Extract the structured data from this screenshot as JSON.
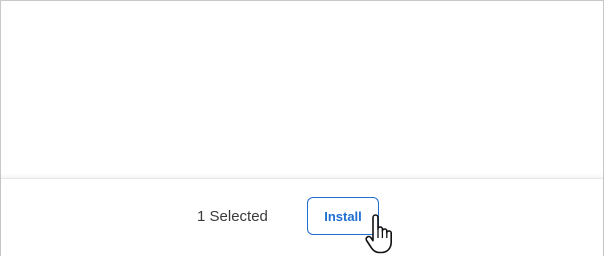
{
  "footer": {
    "selected_text": "1 Selected",
    "install_label": "Install"
  },
  "colors": {
    "accent": "#1f6fd1",
    "text": "#3a3a3a",
    "border": "#c8c8c8"
  },
  "icons": {
    "cursor": "hand-pointer-icon"
  }
}
